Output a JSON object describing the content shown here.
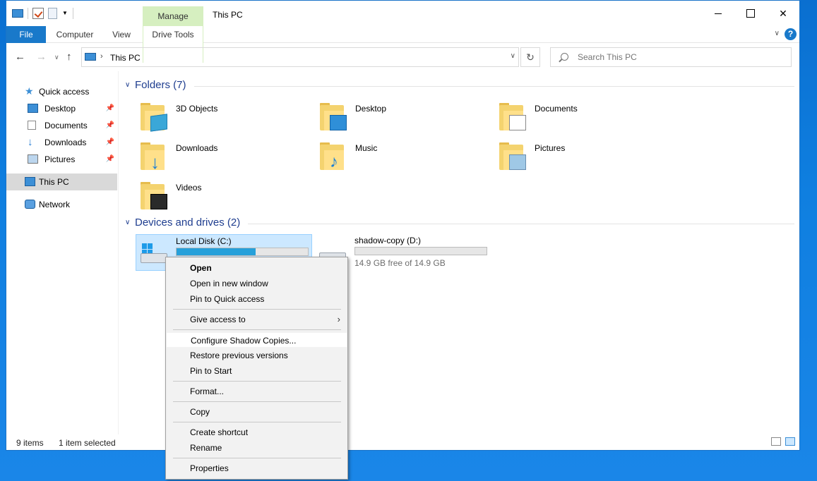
{
  "window": {
    "title": "This PC",
    "manage_tab": "Manage"
  },
  "ribbon": {
    "tabs": [
      "File",
      "Computer",
      "View",
      "Drive Tools"
    ],
    "help": "?"
  },
  "address": {
    "path": "This PC",
    "search_placeholder": "Search This PC"
  },
  "navpane": {
    "quick_access": "Quick access",
    "pinned": [
      "Desktop",
      "Documents",
      "Downloads",
      "Pictures"
    ],
    "this_pc": "This PC",
    "network": "Network"
  },
  "folders": {
    "header": "Folders (7)",
    "items": [
      "3D Objects",
      "Desktop",
      "Documents",
      "Downloads",
      "Music",
      "Pictures",
      "Videos"
    ]
  },
  "drives": {
    "header": "Devices and drives (2)",
    "items": [
      {
        "name": "Local Disk (C:)",
        "used_fraction": 0.6,
        "free_text": ""
      },
      {
        "name": "shadow-copy (D:)",
        "used_fraction": 0.0,
        "free_text": "14.9 GB free of 14.9 GB"
      }
    ]
  },
  "statusbar": {
    "item_count": "9 items",
    "selection": "1 item selected"
  },
  "context_menu": {
    "items": [
      "Open",
      "Open in new window",
      "Pin to Quick access",
      "Give access to",
      "Configure Shadow Copies...",
      "Restore previous versions",
      "Pin to Start",
      "Format...",
      "Copy",
      "Create shortcut",
      "Rename",
      "Properties"
    ],
    "highlighted": "Configure Shadow Copies..."
  },
  "colors": {
    "accent": "#1979ca",
    "group_header": "#1e3d8f",
    "selection": "#cce8ff",
    "drive_bar": "#26a0da",
    "manage_tab": "#d6efc0"
  }
}
